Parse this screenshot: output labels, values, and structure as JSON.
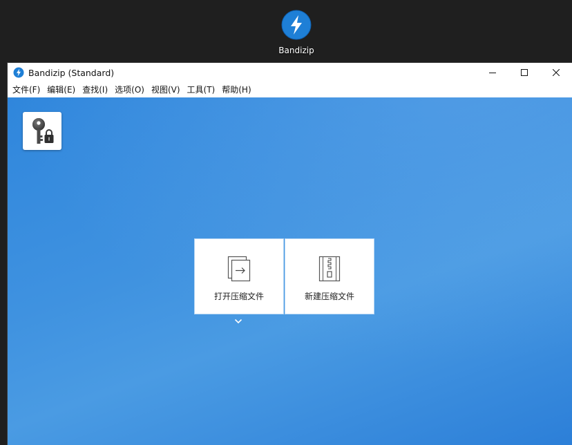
{
  "desktop": {
    "icon_label": "Bandizip",
    "icon": "bandizip-logo-icon"
  },
  "window": {
    "title": "Bandizip (Standard)",
    "controls": {
      "minimize": "minimize-icon",
      "maximize": "maximize-icon",
      "close": "close-icon"
    }
  },
  "menu": {
    "items": [
      {
        "label": "文件(F)"
      },
      {
        "label": "编辑(E)"
      },
      {
        "label": "查找(I)"
      },
      {
        "label": "选项(O)"
      },
      {
        "label": "视图(V)"
      },
      {
        "label": "工具(T)"
      },
      {
        "label": "帮助(H)"
      }
    ]
  },
  "main": {
    "password_manager_icon": "key-lock-icon",
    "actions": [
      {
        "label": "打开压缩文件",
        "icon": "open-archive-icon"
      },
      {
        "label": "新建压缩文件",
        "icon": "new-archive-icon"
      }
    ],
    "dropdown_icon": "chevron-down-icon"
  },
  "colors": {
    "background_blue": "#3a8ee0",
    "logo_blue": "#1e7fd6"
  }
}
